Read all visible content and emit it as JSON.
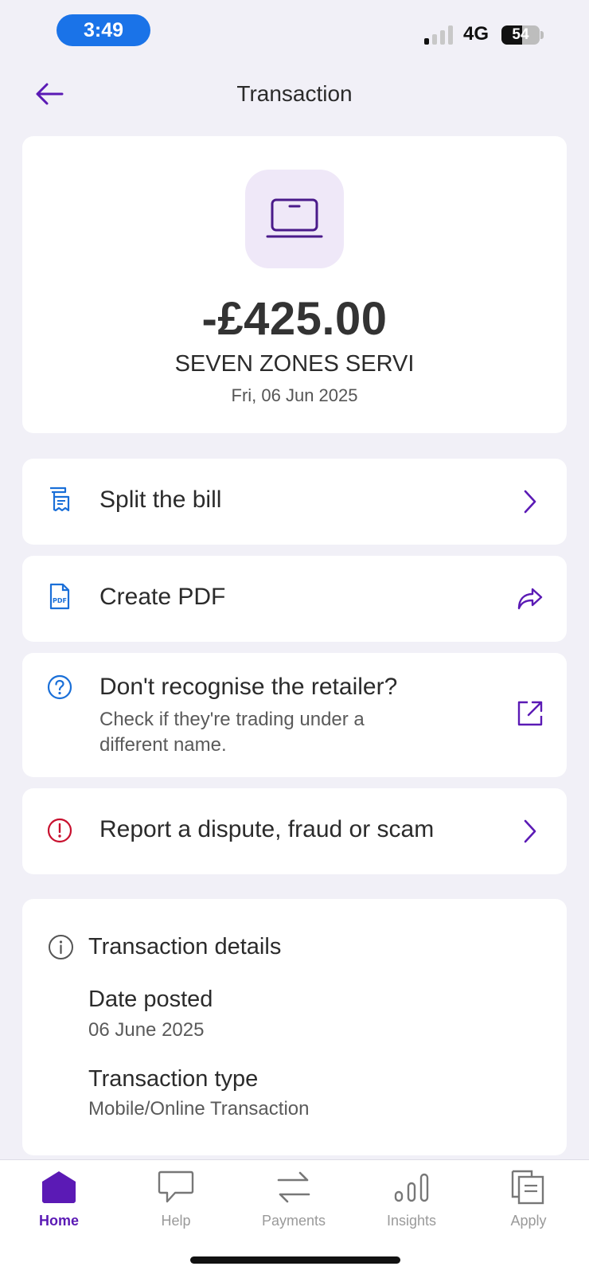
{
  "status_bar": {
    "time": "3:49",
    "network": "4G",
    "battery": "54"
  },
  "header": {
    "title": "Transaction",
    "back_icon": "arrow-left-icon"
  },
  "summary": {
    "icon": "laptop-icon",
    "amount": "-£425.00",
    "merchant": "SEVEN ZONES SERVI",
    "date": "Fri, 06 Jun 2025"
  },
  "actions": {
    "split": {
      "label": "Split the bill",
      "icon": "receipt-icon",
      "trail_icon": "chevron-right-icon"
    },
    "pdf": {
      "label": "Create PDF",
      "icon": "pdf-icon",
      "trail_icon": "share-icon"
    },
    "recognise": {
      "label": "Don't recognise the retailer?",
      "sub_line1": "Check if they're trading under a",
      "sub_line2": "different name.",
      "icon": "question-icon",
      "trail_icon": "external-link-icon"
    },
    "dispute": {
      "label": "Report a dispute, fraud or scam",
      "icon": "alert-icon",
      "trail_icon": "chevron-right-icon"
    }
  },
  "details": {
    "title": "Transaction details",
    "date_posted_label": "Date posted",
    "date_posted_value": "06 June 2025",
    "type_label": "Transaction type",
    "type_value": "Mobile/Online Transaction"
  },
  "tabs": [
    {
      "label": "Home",
      "icon": "home-icon",
      "active": true
    },
    {
      "label": "Help",
      "icon": "chat-bubble-icon",
      "active": false
    },
    {
      "label": "Payments",
      "icon": "transfer-arrows-icon",
      "active": false
    },
    {
      "label": "Insights",
      "icon": "bar-chart-icon",
      "active": false
    },
    {
      "label": "Apply",
      "icon": "documents-icon",
      "active": false
    }
  ],
  "colors": {
    "accent": "#5b1ab5",
    "background": "#f1f0f7",
    "info_blue": "#1a6fd8",
    "alert_red": "#c8102e",
    "status_pill": "#1a73e8"
  }
}
